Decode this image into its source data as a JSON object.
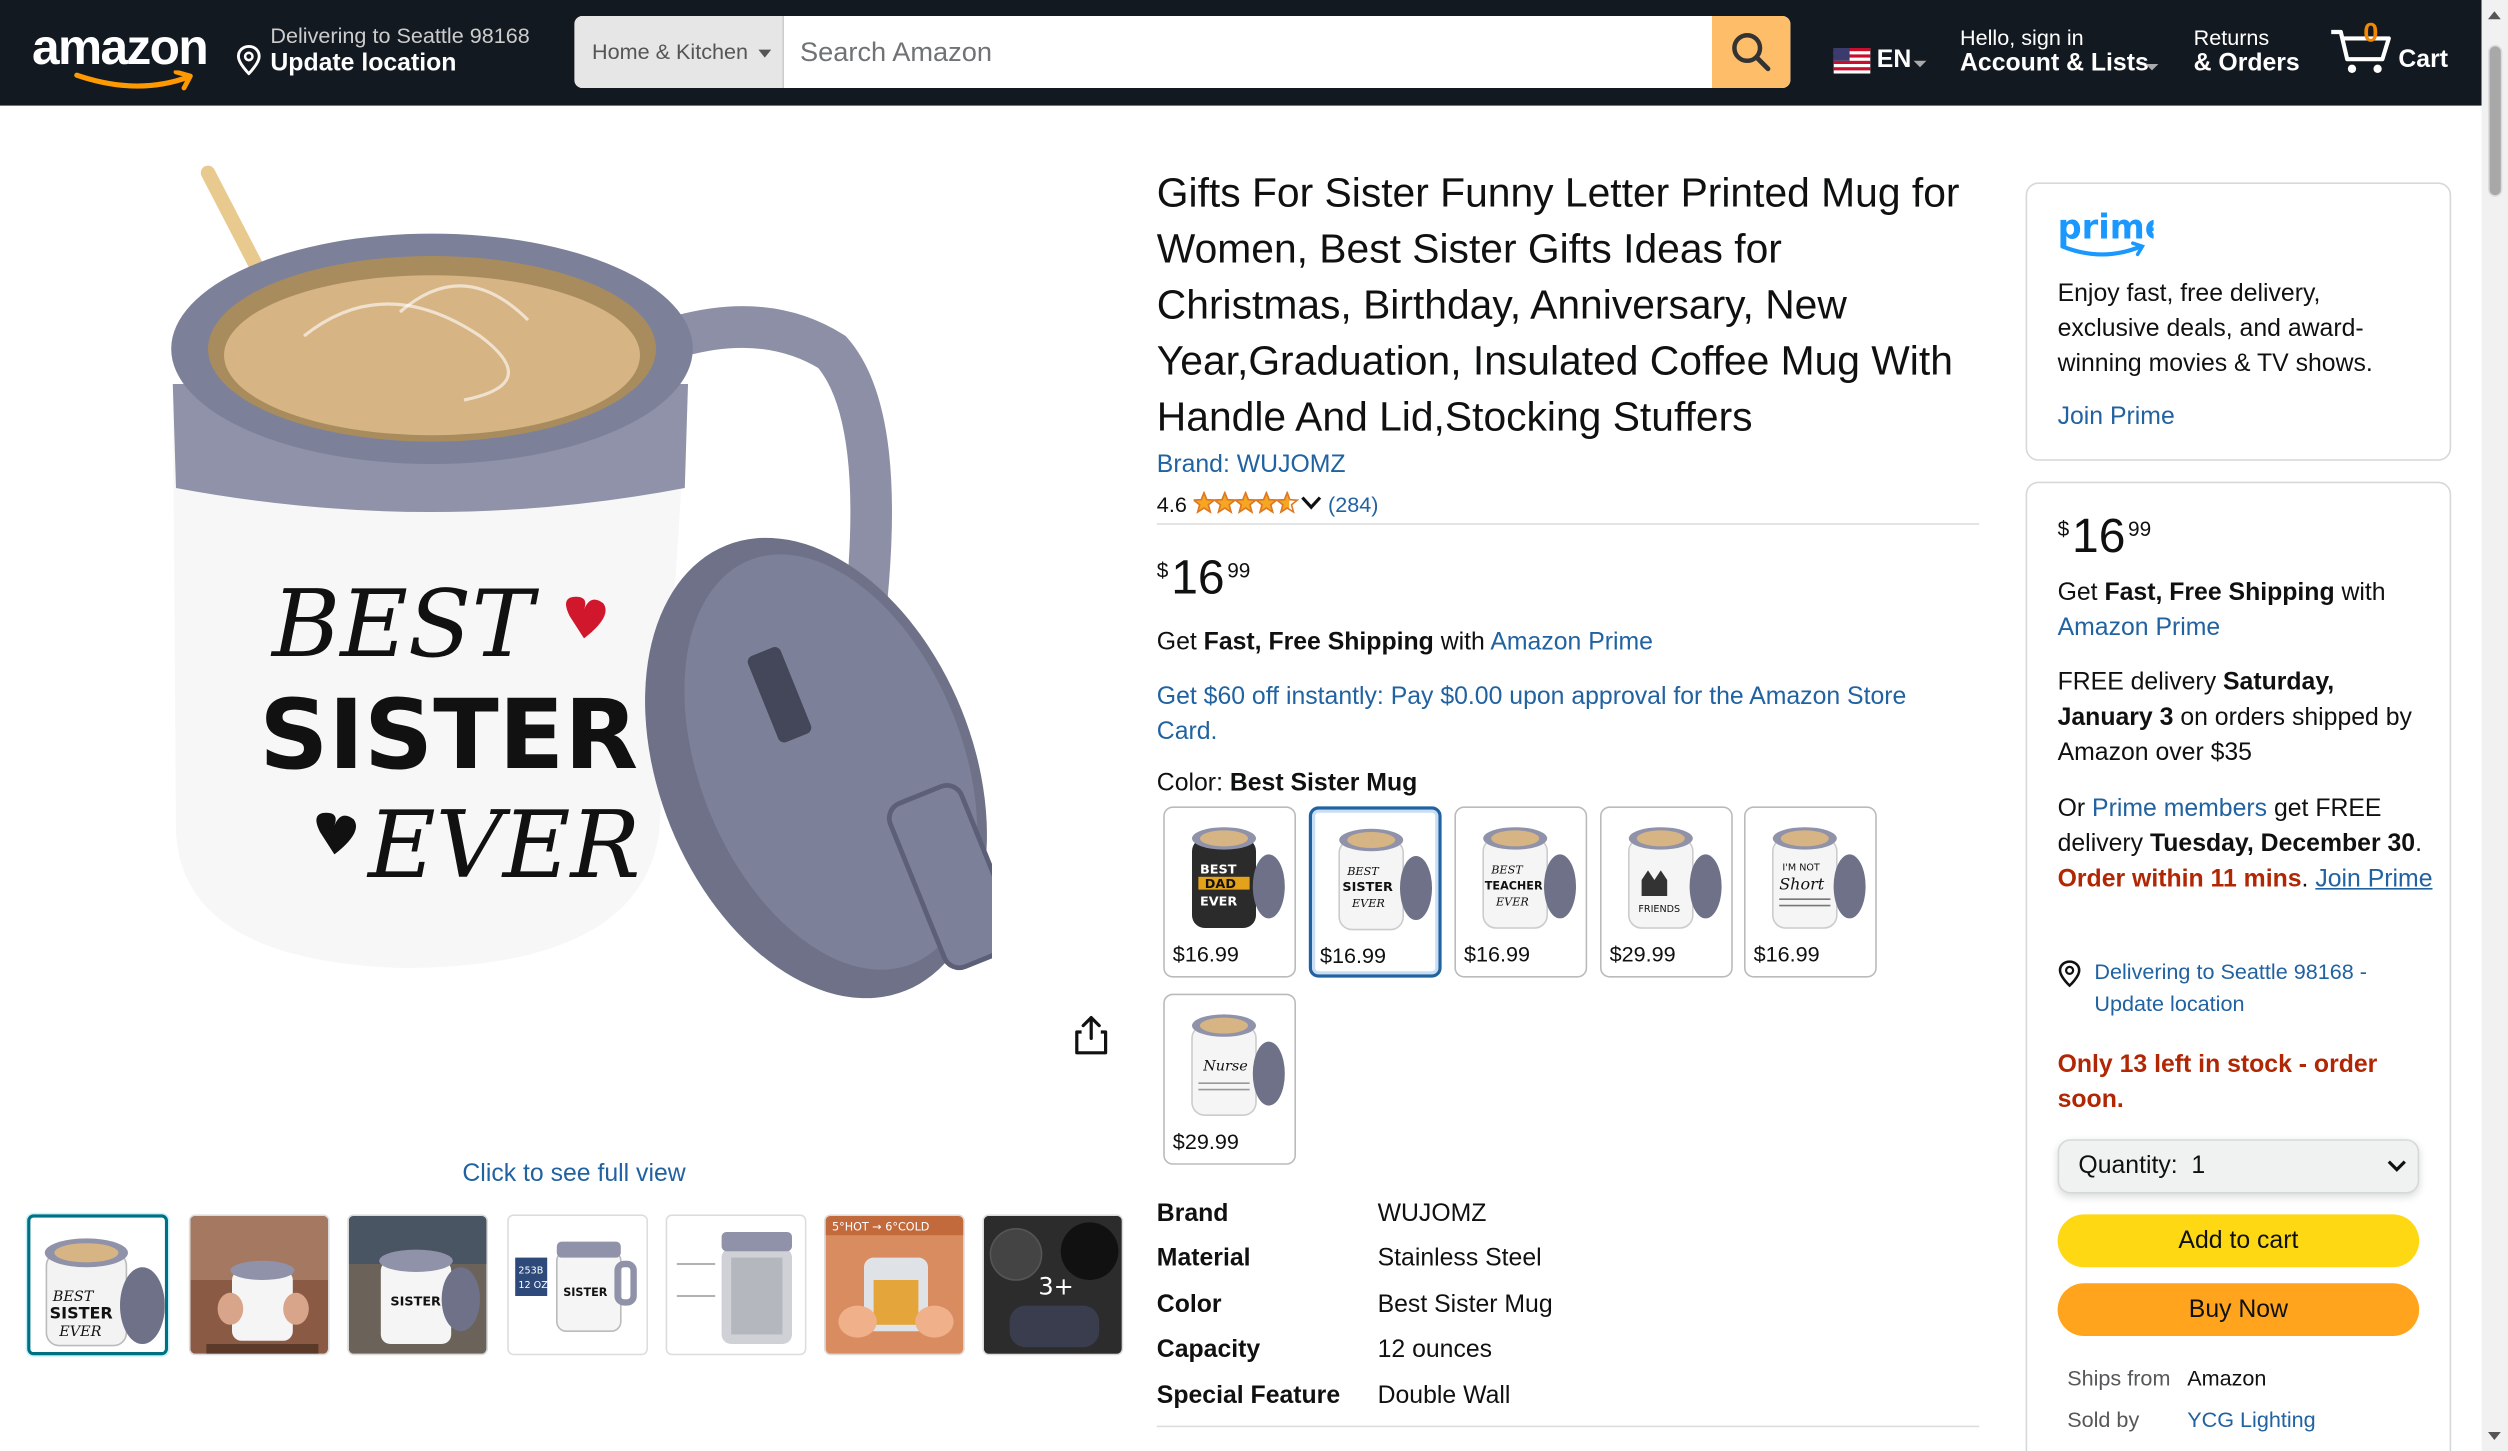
{
  "header": {
    "logo_text": "amazon",
    "deliver_line1": "Delivering to Seattle 98168",
    "deliver_line2": "Update location",
    "search_category": "Home & Kitchen",
    "search_placeholder": "Search Amazon",
    "language": "EN",
    "account_line1": "Hello, sign in",
    "account_line2": "Account & Lists",
    "returns_line1": "Returns",
    "returns_line2": "& Orders",
    "cart_count": "0",
    "cart_label": "Cart",
    "colors": {
      "bar": "#131921",
      "search_button": "#febd69",
      "cart_count": "#f08804"
    }
  },
  "gallery": {
    "main_image_text": [
      "BEST",
      "SISTER",
      "EVER"
    ],
    "full_view_label": "Click to see full view",
    "thumbnails": [
      {
        "name": "thumb-1",
        "selected": true
      },
      {
        "name": "thumb-2"
      },
      {
        "name": "thumb-3"
      },
      {
        "name": "thumb-4",
        "badge": "253 B 12 OZ"
      },
      {
        "name": "thumb-5"
      },
      {
        "name": "thumb-6",
        "badge": "5°HOT → 6°COLD"
      },
      {
        "name": "thumb-7",
        "overlay": "3+"
      }
    ]
  },
  "product": {
    "title": "Gifts For Sister Funny Letter Printed Mug for Women, Best Sister Gifts Ideas for Christmas, Birthday, Anniversary, New Year,Graduation, Insulated Coffee Mug With Handle And Lid,Stocking Stuffers",
    "brand_link": "Brand: WUJOMZ",
    "rating": "4.6",
    "rating_value": 4.6,
    "review_count": "(284)",
    "price_symbol": "$",
    "price_whole": "16",
    "price_fraction": "99",
    "shipping_prefix": "Get ",
    "shipping_bold": "Fast, Free Shipping",
    "shipping_mid": " with ",
    "shipping_link": "Amazon Prime",
    "promo": "Get $60 off instantly: Pay $0.00 upon approval for the Amazon Store Card.",
    "color_label": "Color: ",
    "color_value": "Best Sister Mug",
    "swatches": [
      {
        "price": "$16.99",
        "text": "BEST DAD EVER"
      },
      {
        "price": "$16.99",
        "text": "BEST SISTER EVER",
        "selected": true
      },
      {
        "price": "$16.99",
        "text": "BEST TEACHER EVER"
      },
      {
        "price": "$29.99",
        "text": "CAT FRIENDS"
      },
      {
        "price": "$16.99",
        "text": "I'M NOT SHORT"
      },
      {
        "price": "$29.99",
        "text": "Nurse"
      }
    ],
    "specs": [
      {
        "key": "Brand",
        "value": "WUJOMZ"
      },
      {
        "key": "Material",
        "value": "Stainless Steel"
      },
      {
        "key": "Color",
        "value": "Best Sister Mug"
      },
      {
        "key": "Capacity",
        "value": "12 ounces"
      },
      {
        "key": "Special Feature",
        "value": "Double Wall"
      }
    ]
  },
  "prime_box": {
    "logo": "prime",
    "text": "Enjoy fast, free delivery, exclusive deals, and award-winning movies & TV shows.",
    "join": "Join Prime"
  },
  "buy_box": {
    "price_symbol": "$",
    "price_whole": "16",
    "price_fraction": "99",
    "ship_get": "Get ",
    "ship_bold": "Fast, Free Shipping",
    "ship_with": " with",
    "ship_link": "Amazon Prime",
    "free_delivery_prefix": "FREE delivery ",
    "free_delivery_date": "Saturday, January 3",
    "free_delivery_suffix": " on orders shipped by Amazon over $35",
    "or_text": "Or ",
    "prime_members": "Prime members",
    "get_free": " get FREE delivery ",
    "fast_date": "Tuesday, December 30",
    "period": ".",
    "order_within": "Order within 11 mins",
    "join_prime": "Join Prime",
    "location": "Delivering to Seattle 98168 - Update location",
    "stock": "Only 13 left in stock - order soon.",
    "quantity": "Quantity:  1",
    "add_to_cart": "Add to cart",
    "buy_now": "Buy Now",
    "ships_from_label": "Ships from",
    "ships_from_value": "Amazon",
    "sold_by_label": "Sold by",
    "sold_by_value": "YCG Lighting",
    "colors": {
      "add_to_cart": "#ffd814",
      "buy_now": "#ffa41c",
      "urgent": "#b12704",
      "link": "#2162a1"
    }
  }
}
